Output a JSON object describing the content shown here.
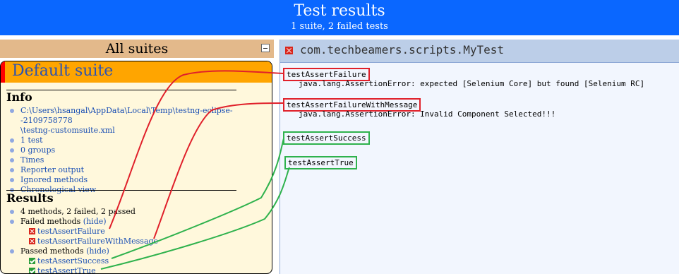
{
  "header": {
    "title": "Test results",
    "subtitle": "1 suite, 2 failed tests"
  },
  "left": {
    "all_suites_label": "All suites",
    "suite_name": "Default suite",
    "info_title": "Info",
    "info_items": [
      "C:\\Users\\hsangal\\AppData\\Local\\Temp\\testng-eclipse--2109758778",
      "\\testng-customsuite.xml",
      "1 test",
      "0 groups",
      "Times",
      "Reporter output",
      "Ignored methods",
      "Chronological view"
    ],
    "results_title": "Results",
    "results_summary": "4 methods, 2 failed, 2 passed",
    "failed_label": "Failed methods",
    "passed_label": "Passed methods",
    "hide_label": "(hide)",
    "failed_methods": [
      "testAssertFailure",
      "testAssertFailureWithMessage"
    ],
    "passed_methods": [
      "testAssertSuccess",
      "testAssertTrue"
    ]
  },
  "right": {
    "class_name": "com.techbeamers.scripts.MyTest",
    "tests": [
      {
        "name": "testAssertFailure",
        "message": "java.lang.AssertionError: expected [Selenium Core] but found [Selenium RC]"
      },
      {
        "name": "testAssertFailureWithMessage",
        "message": "java.lang.AssertionError: Invalid Component Selected!!!"
      },
      {
        "name": "testAssertSuccess",
        "message": ""
      },
      {
        "name": "testAssertTrue",
        "message": ""
      }
    ]
  },
  "colors": {
    "header": "#0a67ff",
    "fail": "#d9261c",
    "pass": "#2a9d3a",
    "annotation_red": "#e0202a",
    "annotation_green": "#2fb24d"
  }
}
